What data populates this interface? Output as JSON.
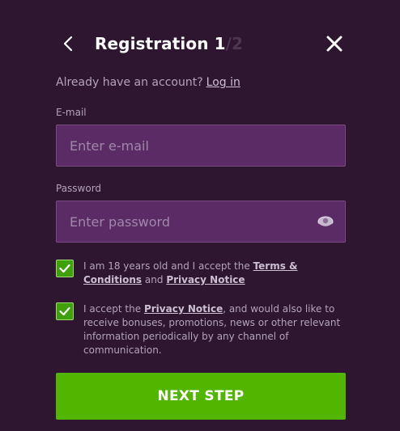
{
  "header": {
    "title_prefix": "Registration",
    "step_current": "1",
    "step_total": "/2"
  },
  "account": {
    "prompt": "Already have an account?",
    "login_label": "Log in"
  },
  "email": {
    "label": "E-mail",
    "placeholder": "Enter e-mail",
    "value": ""
  },
  "password": {
    "label": "Password",
    "placeholder": "Enter password",
    "value": ""
  },
  "consent_terms": {
    "checked": true,
    "text_before": "I am 18 years old and I accept the",
    "terms_link": "Terms & Conditions",
    "text_and": "and",
    "privacy_link": "Privacy Notice"
  },
  "consent_marketing": {
    "checked": true,
    "text_before": "I accept the",
    "privacy_link": "Privacy Notice",
    "text_after": ", and would also like to receive bonuses, promotions, news or other relevant information periodically by any channel of communication."
  },
  "next_button": {
    "label": "NEXT STEP"
  },
  "colors": {
    "background": "#2e1631",
    "input_background": "#5b2b66",
    "accent_green": "#52b500",
    "checkbox_green": "#3fa009",
    "muted_text": "#b3a3b8"
  },
  "icons": {
    "back": "chevron-left-icon",
    "close": "close-icon",
    "password_toggle": "eye-icon",
    "check": "checkmark-icon"
  }
}
